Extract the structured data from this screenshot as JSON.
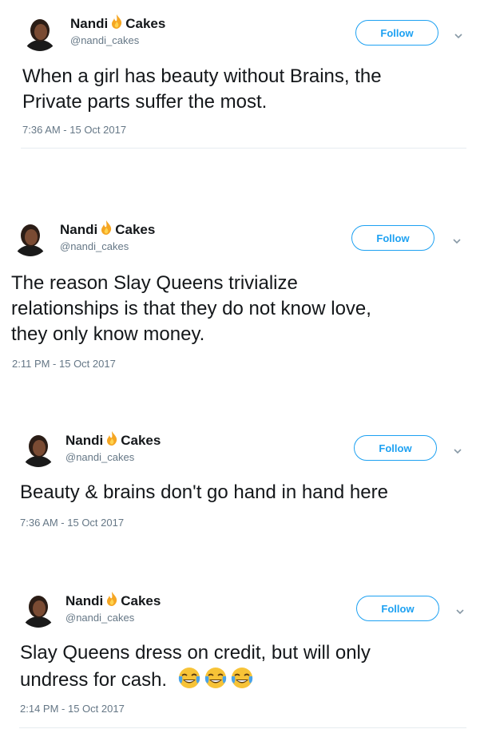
{
  "tweets": [
    {
      "name_first": "Nandi",
      "name_second": "Cakes",
      "handle": "@nandi_cakes",
      "follow_label": "Follow",
      "text_lines": [
        "When a girl has beauty without Brains, the",
        "Private parts suffer the most."
      ],
      "timestamp": "7:36 AM - 15 Oct 2017"
    },
    {
      "name_first": "Nandi",
      "name_second": "Cakes",
      "handle": "@nandi_cakes",
      "follow_label": "Follow",
      "text_lines": [
        "The reason Slay Queens trivialize",
        "relationships is that they do not know love,",
        "they only know money."
      ],
      "timestamp": "2:11 PM - 15 Oct 2017"
    },
    {
      "name_first": "Nandi",
      "name_second": "Cakes",
      "handle": "@nandi_cakes",
      "follow_label": "Follow",
      "text_lines": [
        "Beauty & brains don't go hand in hand here"
      ],
      "timestamp": "7:36 AM - 15 Oct 2017"
    },
    {
      "name_first": "Nandi",
      "name_second": "Cakes",
      "handle": "@nandi_cakes",
      "follow_label": "Follow",
      "text_lines": [
        "Slay Queens dress on credit, but will only",
        "undress for cash."
      ],
      "emoji": "face-with-tears-of-joy-icon x3",
      "timestamp": "2:14 PM - 15 Oct 2017"
    }
  ],
  "colors": {
    "accent": "#1da1f2",
    "text": "#14171a",
    "muted": "#657786",
    "divider": "#e6ecf0",
    "fire": "#f5a623"
  }
}
